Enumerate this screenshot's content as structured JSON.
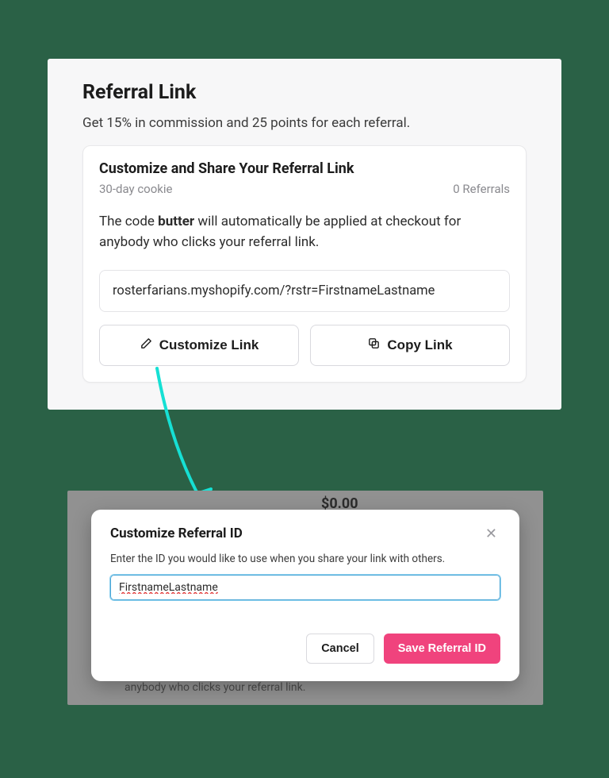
{
  "colors": {
    "accent_pink": "#f0437d",
    "arrow": "#16e0d4"
  },
  "top": {
    "heading": "Referral Link",
    "subtitle": "Get 15% in commission and 25 points for each referral.",
    "card": {
      "title": "Customize and Share Your Referral Link",
      "cookie": "30-day cookie",
      "referrals": "0 Referrals",
      "code_prefix": "The code ",
      "code_value": "butter",
      "code_suffix": " will automatically be applied at checkout for anybody who clicks your referral link.",
      "link_value": "rosterfarians.myshopify.com/?rstr=FirstnameLastname",
      "customize_label": "Customize Link",
      "copy_label": "Copy Link"
    }
  },
  "modal": {
    "title": "Customize Referral ID",
    "description": "Enter the ID you would like to use when you share your link with others.",
    "input_value": "FirstnameLastname",
    "cancel_label": "Cancel",
    "save_label": "Save Referral ID"
  },
  "background_hints": {
    "amount": "$0.00",
    "line": "anybody who clicks your referral link."
  }
}
